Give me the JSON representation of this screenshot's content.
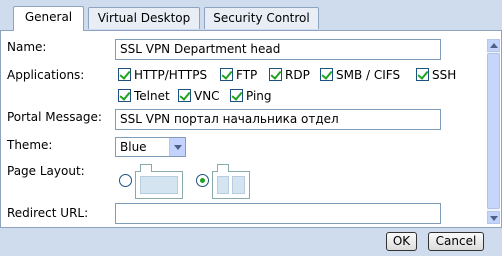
{
  "tabs": [
    {
      "label": "General",
      "active": true
    },
    {
      "label": "Virtual Desktop",
      "active": false
    },
    {
      "label": "Security Control",
      "active": false
    }
  ],
  "form": {
    "name": {
      "label": "Name:",
      "value": "SSL VPN Department head"
    },
    "applications": {
      "label": "Applications:",
      "items": [
        {
          "label": "HTTP/HTTPS",
          "checked": true
        },
        {
          "label": "FTP",
          "checked": true
        },
        {
          "label": "RDP",
          "checked": true
        },
        {
          "label": "SMB / CIFS",
          "checked": true
        },
        {
          "label": "SSH",
          "checked": true
        },
        {
          "label": "Telnet",
          "checked": true
        },
        {
          "label": "VNC",
          "checked": true
        },
        {
          "label": "Ping",
          "checked": true
        }
      ]
    },
    "portal_message": {
      "label": "Portal Message:",
      "value": "SSL VPN портал начальника отдел"
    },
    "theme": {
      "label": "Theme:",
      "selected": "Blue"
    },
    "page_layout": {
      "label": "Page Layout:",
      "options": [
        "single-column",
        "two-column"
      ],
      "selected": "two-column"
    },
    "redirect_url": {
      "label": "Redirect URL:",
      "value": ""
    }
  },
  "footer": {
    "ok_label": "OK",
    "cancel_label": "Cancel"
  },
  "colors": {
    "accent_check": "#21a121",
    "panel_bg": "#cfdcee"
  }
}
